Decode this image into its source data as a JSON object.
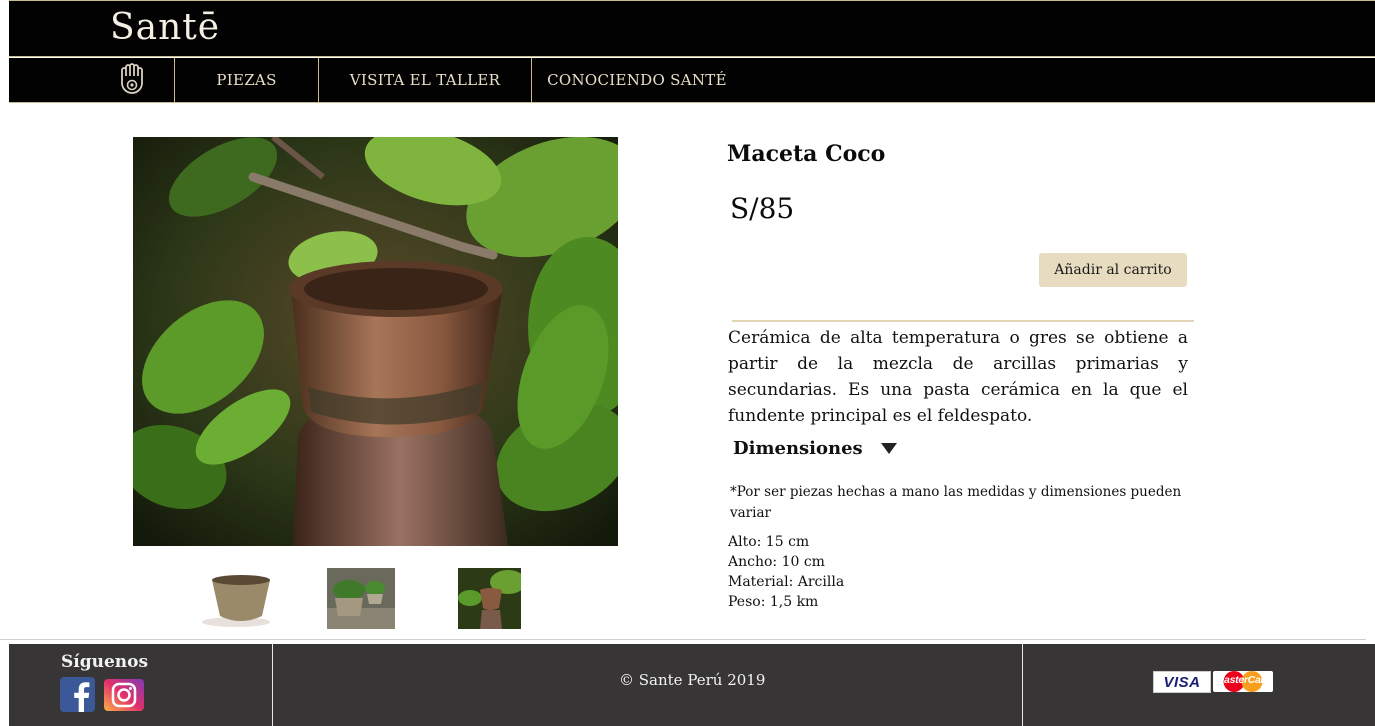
{
  "header": {
    "brand": "Santē"
  },
  "nav": {
    "items": [
      {
        "label": "PIEZAS"
      },
      {
        "label": "VISITA EL TALLER"
      },
      {
        "label": "CONOCIENDO SANTÉ"
      }
    ]
  },
  "product": {
    "title": "Maceta Coco",
    "price": "S/85",
    "add_to_cart": "Añadir al carrito",
    "description": "Cerámica de alta temperatura o gres se  obtiene a partir de la mezcla de arcillas primarias y secundarias. Es una pasta  cerámica en la que el fundente principal es el feldespato.",
    "dimensions_label": "Dimensiones",
    "note": "*Por  ser piezas hechas a mano las medidas y dimensiones pueden variar",
    "specs": {
      "alto": "Alto: 15 cm",
      "ancho": "Ancho: 10 cm",
      "material": "Material:  Arcilla",
      "peso": "Peso:  1,5 km"
    }
  },
  "footer": {
    "follow_label": "Síguenos",
    "copyright": "© Sante Perú 2019",
    "payment": {
      "visa": "VISA",
      "mastercard": "MasterCard"
    }
  },
  "colors": {
    "header_bg": "#020202",
    "nav_text": "#e8dfc8",
    "accent_gold": "#c9b98f",
    "button_bg": "#e8dcc0",
    "footer_bg": "#373535"
  },
  "icons": {
    "logo": "hamsa-hand-icon",
    "dropdown": "triangle-down-icon",
    "facebook": "facebook-icon",
    "instagram": "instagram-icon"
  }
}
